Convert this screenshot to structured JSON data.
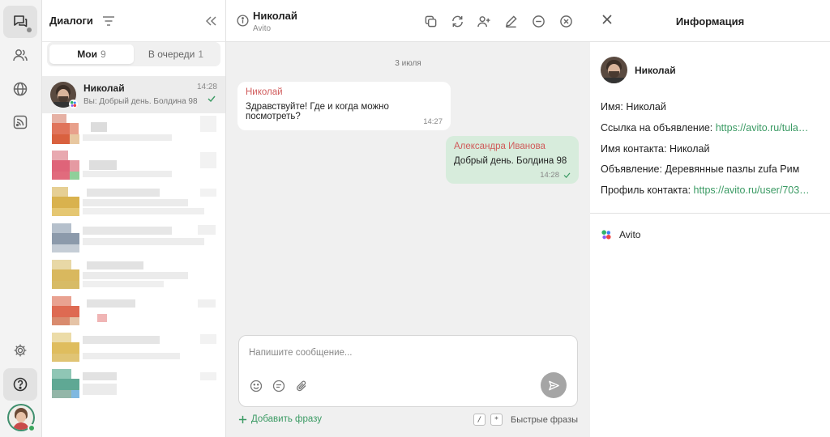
{
  "rail": {
    "items": [
      {
        "name": "dialogs",
        "icon": "chat-bubbles-icon",
        "active": true
      },
      {
        "name": "contacts",
        "icon": "users-icon"
      },
      {
        "name": "web",
        "icon": "globe-icon"
      },
      {
        "name": "feeds",
        "icon": "rss-icon"
      },
      {
        "name": "settings",
        "icon": "gear-icon"
      },
      {
        "name": "help",
        "icon": "question-icon"
      }
    ]
  },
  "dialogs": {
    "title": "Диалоги",
    "tabs": [
      {
        "label": "Мои",
        "count": "9",
        "active": true
      },
      {
        "label": "В очереди",
        "count": "1",
        "active": false
      }
    ],
    "active_chat": {
      "name": "Николай",
      "time": "14:28",
      "preview": "Вы: Добрый день. Болдина 98"
    }
  },
  "chat": {
    "name": "Николай",
    "source": "Avito",
    "date_separator": "3 июля",
    "messages": [
      {
        "author": "Николай",
        "text": "Здравствуйте! Где и когда можно посмотреть?",
        "time": "14:27",
        "direction": "in"
      },
      {
        "author": "Александра Иванова",
        "text": "Добрый день. Болдина 98",
        "time": "14:28",
        "direction": "out"
      }
    ],
    "composer": {
      "placeholder": "Напишите сообщение...",
      "add_phrase": "Добавить фразу",
      "quick_keys": [
        "/",
        "*"
      ],
      "quick_phrases": "Быстрые фразы"
    }
  },
  "info": {
    "title": "Информация",
    "name": "Николай",
    "fields": [
      {
        "label": "Имя:",
        "value": "Николай",
        "link": false
      },
      {
        "label": "Ссылка на объявление:",
        "value": "https://avito.ru/tula…",
        "link": true
      },
      {
        "label": "Имя контакта:",
        "value": "Николай",
        "link": false
      },
      {
        "label": "Объявление:",
        "value": "Деревянные пазлы zufa Рим",
        "link": false
      },
      {
        "label": "Профиль контакта:",
        "value": "https://avito.ru/user/703…",
        "link": true
      }
    ],
    "source": "Avito"
  },
  "colors": {
    "accent_green": "#3a9a63",
    "author_red": "#d05a5a",
    "outgoing_bubble": "#d7ecdc",
    "chat_background": "#f0f0f0"
  }
}
